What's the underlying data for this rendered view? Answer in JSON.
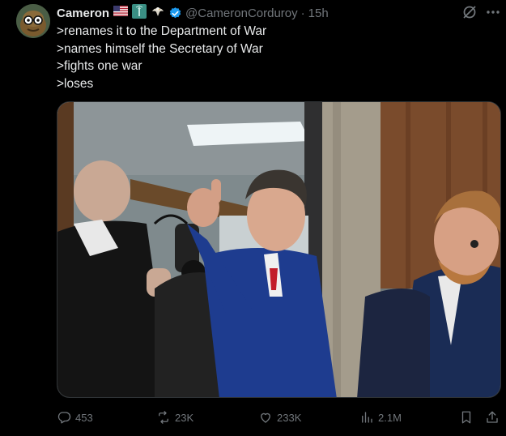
{
  "author": {
    "display_name": "Cameron",
    "handle": "@CameronCorduroy",
    "time": "15h",
    "dot": "·",
    "flags": "🇺🇸",
    "avatar_icon": "cartoon-face-with-glasses-icon",
    "verified_color": "#1d9bf0"
  },
  "tweet": {
    "lines": [
      ">renames it to the Department of War",
      ">names himself the Secretary of War",
      ">fights one war",
      ">loses"
    ]
  },
  "media": {
    "description_icon": "photo"
  },
  "actions": {
    "replies": "453",
    "reposts": "23K",
    "likes": "233K",
    "views": "2.1M"
  },
  "colors": {
    "background": "#000000",
    "text": "#e7e9ea",
    "muted": "#71767b",
    "accent": "#1d9bf0"
  }
}
